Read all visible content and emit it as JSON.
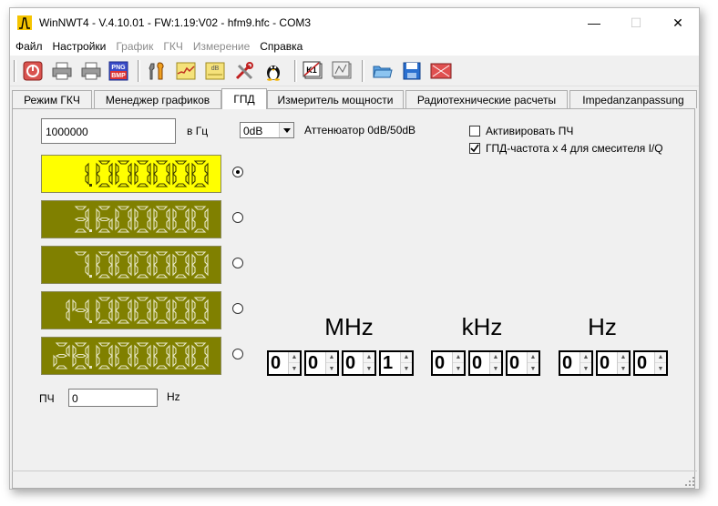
{
  "window": {
    "title": "WinNWT4 - V.4.10.01 - FW:1.19:V02 - hfm9.hfc - COM3",
    "minimize_glyph": "—",
    "maximize_glyph": "☐",
    "close_glyph": "✕"
  },
  "menu": [
    {
      "label": "Файл",
      "enabled": true
    },
    {
      "label": "Настройки",
      "enabled": true
    },
    {
      "label": "График",
      "enabled": false
    },
    {
      "label": "ГКЧ",
      "enabled": false
    },
    {
      "label": "Измерение",
      "enabled": false
    },
    {
      "label": "Справка",
      "enabled": true
    }
  ],
  "toolbar": {
    "icons": [
      "stop-icon",
      "print-icon",
      "print-icon",
      "png-bmp-export-icon",
      "tools-icon",
      "graph-icon",
      "db-icon",
      "tool-settings-icon",
      "linux-tux-icon",
      "k1-icon",
      "calibrate-icon",
      "open-folder-icon",
      "save-icon",
      "clear-icon"
    ],
    "png_bmp_text": "PNG BMP",
    "db_text": "dB",
    "k1_text": "K1"
  },
  "tabs": [
    {
      "label": "Режим ГКЧ",
      "active": false
    },
    {
      "label": "Менеджер графиков",
      "active": false
    },
    {
      "label": "ГПД",
      "active": true
    },
    {
      "label": "Измеритель мощности",
      "active": false
    },
    {
      "label": "Радиотехнические расчеты",
      "active": false
    },
    {
      "label": "Impedanzanpassung",
      "active": false
    }
  ],
  "vfo": {
    "freq_value": "1000000",
    "freq_unit": "в Гц",
    "attenuator_value": "0dB",
    "attenuator_label": "Аттенюатор 0dB/50dB",
    "activate_if_label": "Активировать ПЧ",
    "activate_if_checked": false,
    "quad_label": "ГПД-частота х 4 для смесителя I/Q",
    "quad_checked": true,
    "lcd_values": [
      "1.000000",
      "3.600000",
      "7.000000",
      "14.000000",
      "28.000000"
    ],
    "selected_index": 0,
    "if_label": "ПЧ",
    "if_value": "0",
    "if_unit": "Hz",
    "units": {
      "mhz": "MHz",
      "khz": "kHz",
      "hz": "Hz"
    },
    "mhz_digits": [
      "0",
      "0",
      "0",
      "1"
    ],
    "khz_digits": [
      "0",
      "0",
      "0"
    ],
    "hz_digits": [
      "0",
      "0",
      "0"
    ]
  },
  "colors": {
    "lcd_active_bg": "#ffff00",
    "lcd_bg": "#808000",
    "lcd_active_segment": "#3a3a00",
    "lcd_segment": "#e8e8c8"
  }
}
